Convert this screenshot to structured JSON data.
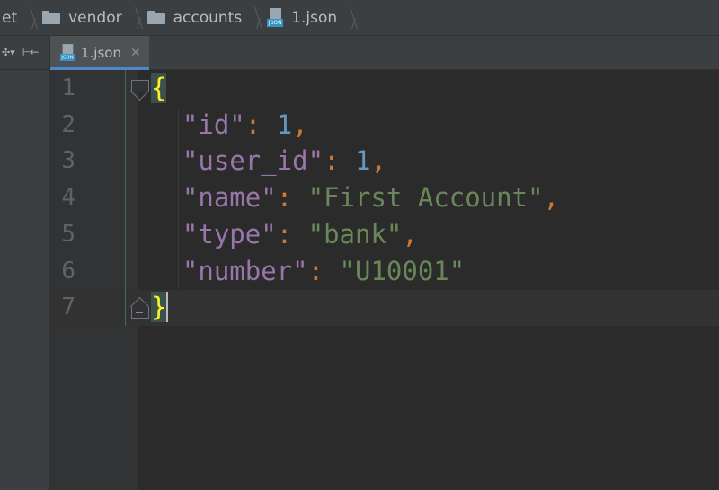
{
  "breadcrumb": {
    "items": [
      {
        "label": "et",
        "icon": null
      },
      {
        "label": "vendor",
        "icon": "folder-icon"
      },
      {
        "label": "accounts",
        "icon": "folder-icon"
      },
      {
        "label": "1.json",
        "icon": "json-file-icon"
      }
    ]
  },
  "tabbar": {
    "active_tab": "1.json",
    "tools": [
      "settings-icon",
      "collapse-icon"
    ]
  },
  "file_icon_badge": "JSON",
  "editor": {
    "line_numbers": [
      "1",
      "2",
      "3",
      "4",
      "5",
      "6",
      "7"
    ],
    "current_line": 7,
    "lines": [
      [
        {
          "t": "{",
          "c": "brace"
        }
      ],
      [
        {
          "t": "  "
        },
        {
          "t": "\"id\"",
          "c": "k"
        },
        {
          "t": ": ",
          "c": "p"
        },
        {
          "t": "1",
          "c": "n"
        },
        {
          "t": ",",
          "c": "p"
        }
      ],
      [
        {
          "t": "  "
        },
        {
          "t": "\"user_id\"",
          "c": "k"
        },
        {
          "t": ": ",
          "c": "p"
        },
        {
          "t": "1",
          "c": "n"
        },
        {
          "t": ",",
          "c": "p"
        }
      ],
      [
        {
          "t": "  "
        },
        {
          "t": "\"name\"",
          "c": "k"
        },
        {
          "t": ": ",
          "c": "p"
        },
        {
          "t": "\"First Account\"",
          "c": "s"
        },
        {
          "t": ",",
          "c": "p"
        }
      ],
      [
        {
          "t": "  "
        },
        {
          "t": "\"type\"",
          "c": "k"
        },
        {
          "t": ": ",
          "c": "p"
        },
        {
          "t": "\"bank\"",
          "c": "s"
        },
        {
          "t": ",",
          "c": "p"
        }
      ],
      [
        {
          "t": "  "
        },
        {
          "t": "\"number\"",
          "c": "k"
        },
        {
          "t": ": ",
          "c": "p"
        },
        {
          "t": "\"U10001\"",
          "c": "s"
        }
      ],
      [
        {
          "t": "}",
          "c": "brace"
        }
      ]
    ]
  },
  "colors": {
    "key": "#9876aa",
    "punct": "#cc7832",
    "number": "#6897bb",
    "string": "#6a8759",
    "brace": "#ffef28",
    "background": "#2b2b2b"
  }
}
